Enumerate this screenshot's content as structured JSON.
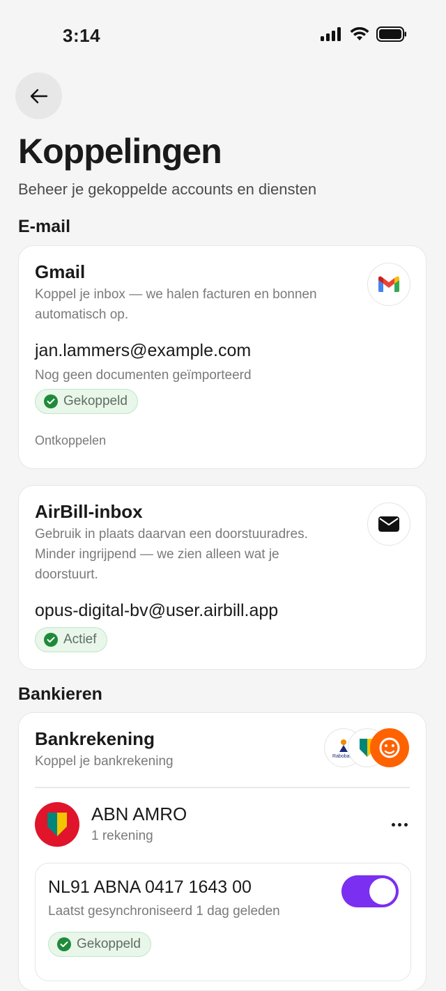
{
  "status_bar": {
    "time": "3:14"
  },
  "header": {
    "title": "Koppelingen",
    "subtitle": "Beheer je gekoppelde accounts en diensten"
  },
  "sections": {
    "email_title": "E-mail",
    "banking_title": "Bankieren"
  },
  "gmail": {
    "title": "Gmail",
    "description_line1": "Koppel je inbox — we halen facturen en bonnen",
    "description_line2": "automatisch op.",
    "account": "jan.lammers@example.com",
    "status_text": "Nog geen documenten geïmporteerd",
    "badge": "Gekoppeld",
    "disconnect": "Ontkoppelen"
  },
  "airbill": {
    "title": "AirBill-inbox",
    "description_line1": "Gebruik in plaats daarvan een doorstuuradres.",
    "description_line2": "Minder ingrijpend — we zien alleen wat je",
    "description_line3": "doorstuurt.",
    "address": "opus-digital-bv@user.airbill.app",
    "badge": "Actief"
  },
  "bank": {
    "title": "Bankrekening",
    "subtitle": "Koppel je bankrekening",
    "rabobank_logo_text": "Rabobank",
    "bank_name": "ABN AMRO",
    "accounts_count": "1 rekening",
    "iban": "NL91 ABNA 0417 1643 00",
    "sync_status": "Laatst gesynchroniseerd 1 dag geleden",
    "badge": "Gekoppeld",
    "sync_enabled": true
  },
  "colors": {
    "accent": "#7b2ff0",
    "success_bg": "#e8f7ea",
    "success_icon": "#1f8a3a",
    "abn_red": "#e0142b",
    "ing_orange": "#ff6200"
  }
}
